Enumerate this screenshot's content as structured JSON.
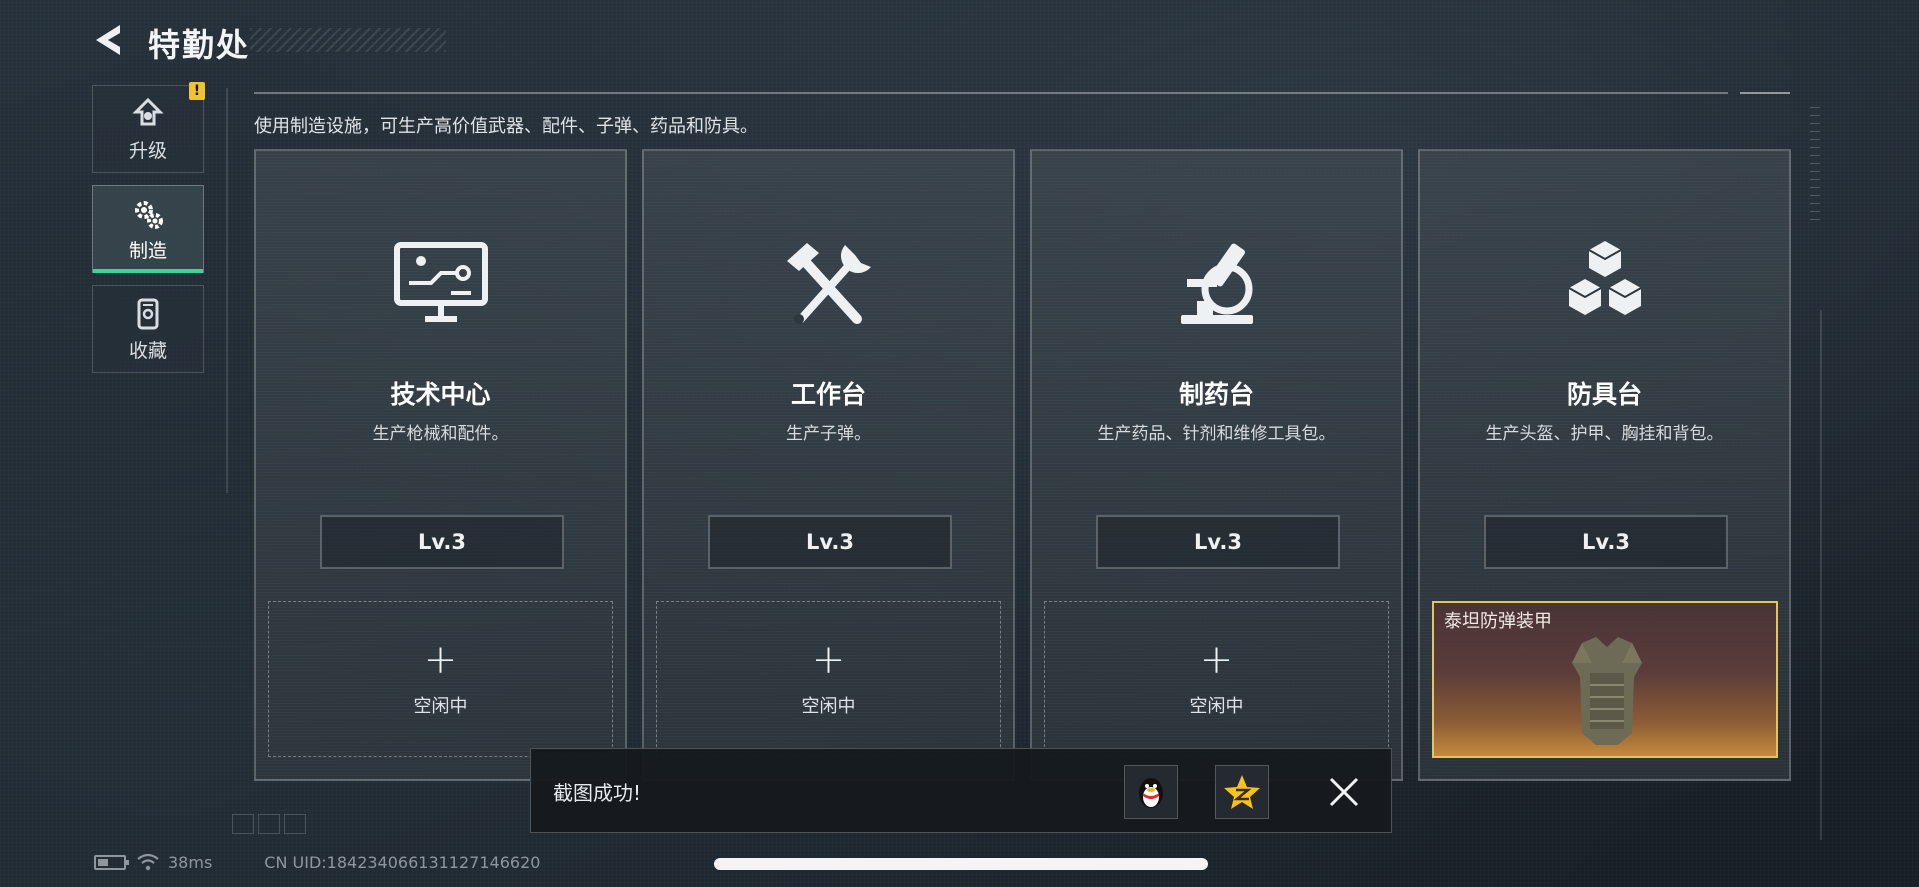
{
  "header": {
    "title": "特勤处"
  },
  "sidebar": {
    "items": [
      {
        "label": "升级",
        "icon": "upgrade-icon",
        "badge": "!"
      },
      {
        "label": "制造",
        "icon": "gears-icon",
        "active": true
      },
      {
        "label": "收藏",
        "icon": "collection-icon"
      }
    ]
  },
  "main": {
    "description": "使用制造设施，可生产高价值武器、配件、子弹、药品和防具。",
    "cards": [
      {
        "title": "技术中心",
        "subtitle": "生产枪械和配件。",
        "level": "Lv.3",
        "icon": "monitor-circuit-icon",
        "slot_label": "空闲中"
      },
      {
        "title": "工作台",
        "subtitle": "生产子弹。",
        "level": "Lv.3",
        "icon": "hammer-wrench-icon",
        "slot_label": "空闲中"
      },
      {
        "title": "制药台",
        "subtitle": "生产药品、针剂和维修工具包。",
        "level": "Lv.3",
        "icon": "microscope-icon",
        "slot_label": "空闲中"
      },
      {
        "title": "防具台",
        "subtitle": "生产头盔、护甲、胸挂和背包。",
        "level": "Lv.3",
        "icon": "boxes-icon",
        "item_name": "泰坦防弹装甲"
      }
    ]
  },
  "toast": {
    "text": "截图成功!"
  },
  "footer": {
    "ping": "38ms",
    "uid": "CN UID:184234066131127146620"
  },
  "colors": {
    "accent_green": "#3ed39a",
    "warn_yellow": "#f2c230",
    "item_border_gold": "#e4c45e"
  }
}
